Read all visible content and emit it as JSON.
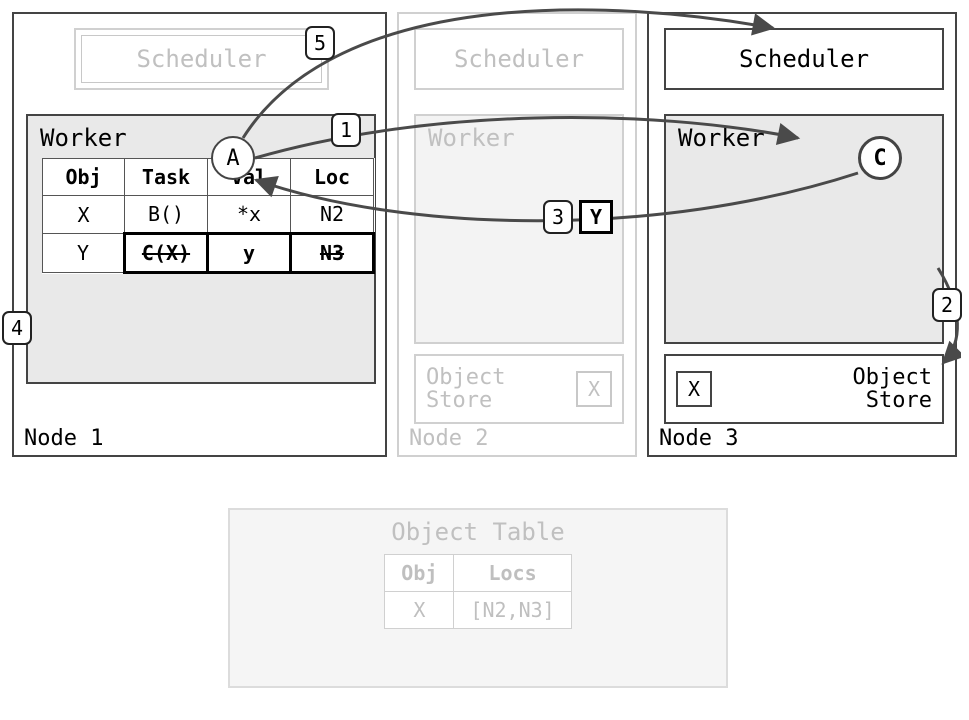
{
  "nodes": {
    "n1": {
      "label": "Node 1",
      "scheduler": "Scheduler",
      "worker": "Worker"
    },
    "n2": {
      "label": "Node 2",
      "scheduler": "Scheduler",
      "worker": "Worker"
    },
    "n3": {
      "label": "Node 3",
      "scheduler": "Scheduler",
      "worker": "Worker"
    }
  },
  "task_circles": {
    "A": "A",
    "C": "C"
  },
  "local_table": {
    "headers": {
      "obj": "Obj",
      "task": "Task",
      "val": "Val",
      "loc": "Loc"
    },
    "rows": [
      {
        "obj": "X",
        "task": "B()",
        "val": "*x",
        "loc": "N2",
        "emph": false,
        "strike": []
      },
      {
        "obj": "Y",
        "task": "C(X)",
        "val": "y",
        "loc": "N3",
        "emph": true,
        "strike": [
          "task",
          "loc"
        ]
      }
    ]
  },
  "object_store": {
    "label_line1": "Object",
    "label_line2": "Store",
    "x_chip": "X"
  },
  "steps": {
    "s1": "1",
    "s2": "2",
    "s3": "3",
    "s4": "4",
    "s5": "5"
  },
  "y_transfer_label": "Y",
  "global_object_table": {
    "title": "Object Table",
    "headers": {
      "obj": "Obj",
      "locs": "Locs"
    },
    "row": {
      "obj": "X",
      "locs": "[N2,N3]"
    }
  }
}
